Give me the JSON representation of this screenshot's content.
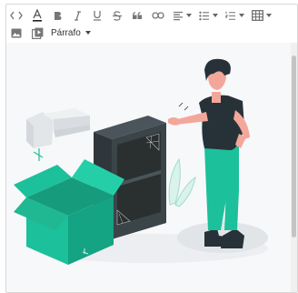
{
  "toolbar": {
    "row1": [
      {
        "name": "code-view-button",
        "icon": "code-icon"
      },
      {
        "name": "text-color-button",
        "icon": "text-color-icon"
      },
      {
        "name": "bold-button",
        "icon": "bold-icon"
      },
      {
        "name": "italic-button",
        "icon": "italic-icon"
      },
      {
        "name": "underline-button",
        "icon": "underline-icon"
      },
      {
        "name": "strikethrough-button",
        "icon": "strikethrough-icon"
      },
      {
        "name": "quote-button",
        "icon": "quote-icon"
      },
      {
        "name": "link-button",
        "icon": "link-icon"
      },
      {
        "name": "align-dropdown",
        "icon": "align-left-icon"
      },
      {
        "name": "bullet-list-dropdown",
        "icon": "bullet-list-icon"
      },
      {
        "name": "numbered-list-dropdown",
        "icon": "numbered-list-icon"
      },
      {
        "name": "table-dropdown",
        "icon": "table-icon"
      }
    ],
    "row2": [
      {
        "name": "insert-image-button",
        "icon": "image-icon"
      },
      {
        "name": "insert-media-button",
        "icon": "media-icon"
      }
    ],
    "format_select": {
      "value": "Párrafo"
    },
    "text_color_accent": "#222222"
  },
  "content": {
    "illustration": "person-with-empty-shelf-and-box-illustration",
    "colors": {
      "teal": "#1cc09a",
      "dark_teal": "#169c7c",
      "shelf": "#3b4449",
      "skin": "#f3a79a",
      "hair": "#263238"
    }
  }
}
